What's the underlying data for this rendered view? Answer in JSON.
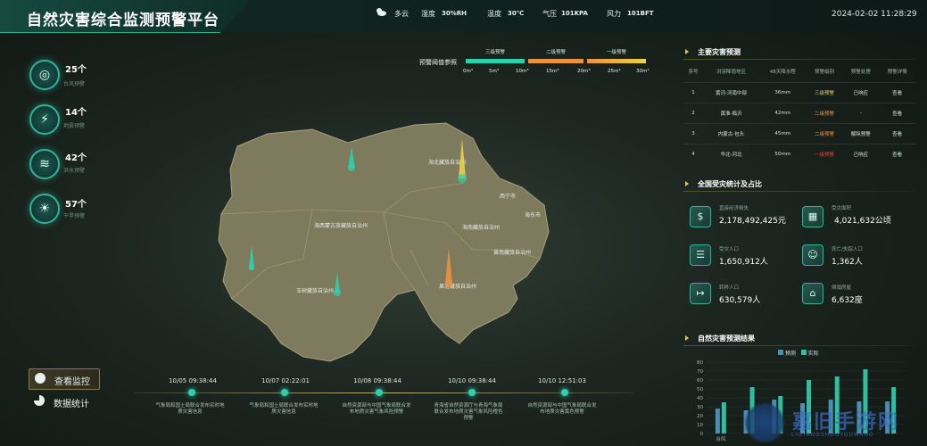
{
  "header": {
    "title": "自然灾害综合监测预警平台",
    "weather": {
      "label": "多云",
      "icon": "cloud-sun-icon"
    },
    "humidity": {
      "label": "湿度",
      "value": "30%RH"
    },
    "temperature": {
      "label": "温度",
      "value": "30℃"
    },
    "pressure": {
      "label": "气压",
      "value": "101KPA"
    },
    "wind": {
      "label": "风力",
      "value": "101BFT"
    },
    "datetime": "2024-02-02 11:28:29"
  },
  "left_stats": [
    {
      "count": "25个",
      "label": "台风预警",
      "icon": "typhoon-icon"
    },
    {
      "count": "14个",
      "label": "地震预警",
      "icon": "earthquake-icon"
    },
    {
      "count": "42个",
      "label": "洪水预警",
      "icon": "flood-icon"
    },
    {
      "count": "57个",
      "label": "干旱预警",
      "icon": "drought-icon"
    }
  ],
  "nav": {
    "monitor": "查看监控",
    "stats": "数据统计"
  },
  "legend": {
    "title": "预警阈值参照",
    "levels": [
      "三级预警",
      "二级预警",
      "一级预警"
    ],
    "level_colors": [
      "#2fd0ac",
      "#e9943d",
      "#e8d248"
    ],
    "ticks": [
      "0m³",
      "5m³",
      "10m³",
      "15m³",
      "20m³",
      "25m³",
      "30m³"
    ]
  },
  "map": {
    "regions": [
      "海北藏族自治州",
      "西宁市",
      "海东市",
      "海西蒙古族藏族自治州",
      "海南藏族自治州",
      "黄南藏族自治州",
      "玉树藏族自治州",
      "果洛藏族自治州"
    ],
    "markers": [
      {
        "name": "marker-haixi-north",
        "color": "#2fd0ac"
      },
      {
        "name": "marker-haibei",
        "color": "#e8d248"
      },
      {
        "name": "marker-west",
        "color": "#2fd0ac"
      },
      {
        "name": "marker-yushu",
        "color": "#2fd0ac"
      },
      {
        "name": "marker-guoluo",
        "color": "#e9943d"
      }
    ]
  },
  "timeline": [
    {
      "date": "10/05 09:38:44",
      "text": "气象局和国土局联合发布实时地质灾害信息"
    },
    {
      "date": "10/07 02:22:01",
      "text": "气象局和国土局联合发布实时地质灾害信息"
    },
    {
      "date": "10/08 09:38:44",
      "text": "自然资源部与中国气象局联合发布地质灾害气象风险预警"
    },
    {
      "date": "10/10 09:38:44",
      "text": "青海省自然资源厅与青海气象局联合发布地质灾害气象风险橙色预警"
    },
    {
      "date": "10/10 12:51:03",
      "text": "自然资源部与中国气象局联合发布地质灾害黄色预警"
    }
  ],
  "disaster_forecast": {
    "title": "主要灾害预测",
    "columns": [
      "序号",
      "洪涝降雨地区",
      "48天降水程",
      "预警级别",
      "预警处理",
      "预警详情"
    ],
    "rows": [
      {
        "no": "1",
        "region": "黄河-河南中部",
        "rain": "36mm",
        "level": "三级预警",
        "level_class": "lvl-yellow",
        "status": "已响应",
        "detail": "查看"
      },
      {
        "no": "2",
        "region": "黄淮-临沂",
        "rain": "42mm",
        "level": "二级预警",
        "level_class": "lvl-orange",
        "status": "-",
        "detail": "查看"
      },
      {
        "no": "3",
        "region": "内蒙古-包头",
        "rain": "45mm",
        "level": "二级预警",
        "level_class": "lvl-orange",
        "status": "解除预警",
        "detail": "查看"
      },
      {
        "no": "4",
        "region": "华北-河北",
        "rain": "50mm",
        "level": "一级预警",
        "level_class": "lvl-red",
        "status": "已响应",
        "detail": "查看"
      }
    ]
  },
  "national_stats": {
    "title": "全国受灾统计及占比",
    "items": [
      {
        "label": "直接经济损失",
        "value": "2,178,492,425元",
        "icon": "money-bag-icon"
      },
      {
        "label": "受灾面积",
        "value": "4,021,632公顷",
        "icon": "farmland-icon"
      },
      {
        "label": "受灾人口",
        "value": "1,650,912人",
        "icon": "people-icon"
      },
      {
        "label": "死亡/失踪人口",
        "value": "1,362人",
        "icon": "missing-person-icon"
      },
      {
        "label": "转移人口",
        "value": "630,579人",
        "icon": "evacuation-icon"
      },
      {
        "label": "倒塌房屋",
        "value": "6,632座",
        "icon": "collapsed-house-icon"
      }
    ]
  },
  "chart_title": "自然灾害预测结果",
  "chart_data": {
    "type": "bar",
    "title": "自然灾害预测结果",
    "series": [
      {
        "name": "预测",
        "color": "#4a8fb3",
        "values": [
          28,
          26,
          38,
          34,
          38,
          36,
          36
        ]
      },
      {
        "name": "实际",
        "color": "#2fbfa0",
        "values": [
          35,
          52,
          42,
          60,
          64,
          72,
          52
        ]
      }
    ],
    "categories": [
      "台风",
      "",
      "",
      "",
      "",
      "",
      ""
    ],
    "ylim": [
      0,
      80
    ],
    "yticks": [
      "0",
      "10",
      "20",
      "30",
      "40",
      "50",
      "60",
      "70",
      "80"
    ],
    "legend_position": "top-center",
    "grid": true
  },
  "watermark": {
    "text": "LIUYANGSHOUYOUWANG"
  }
}
